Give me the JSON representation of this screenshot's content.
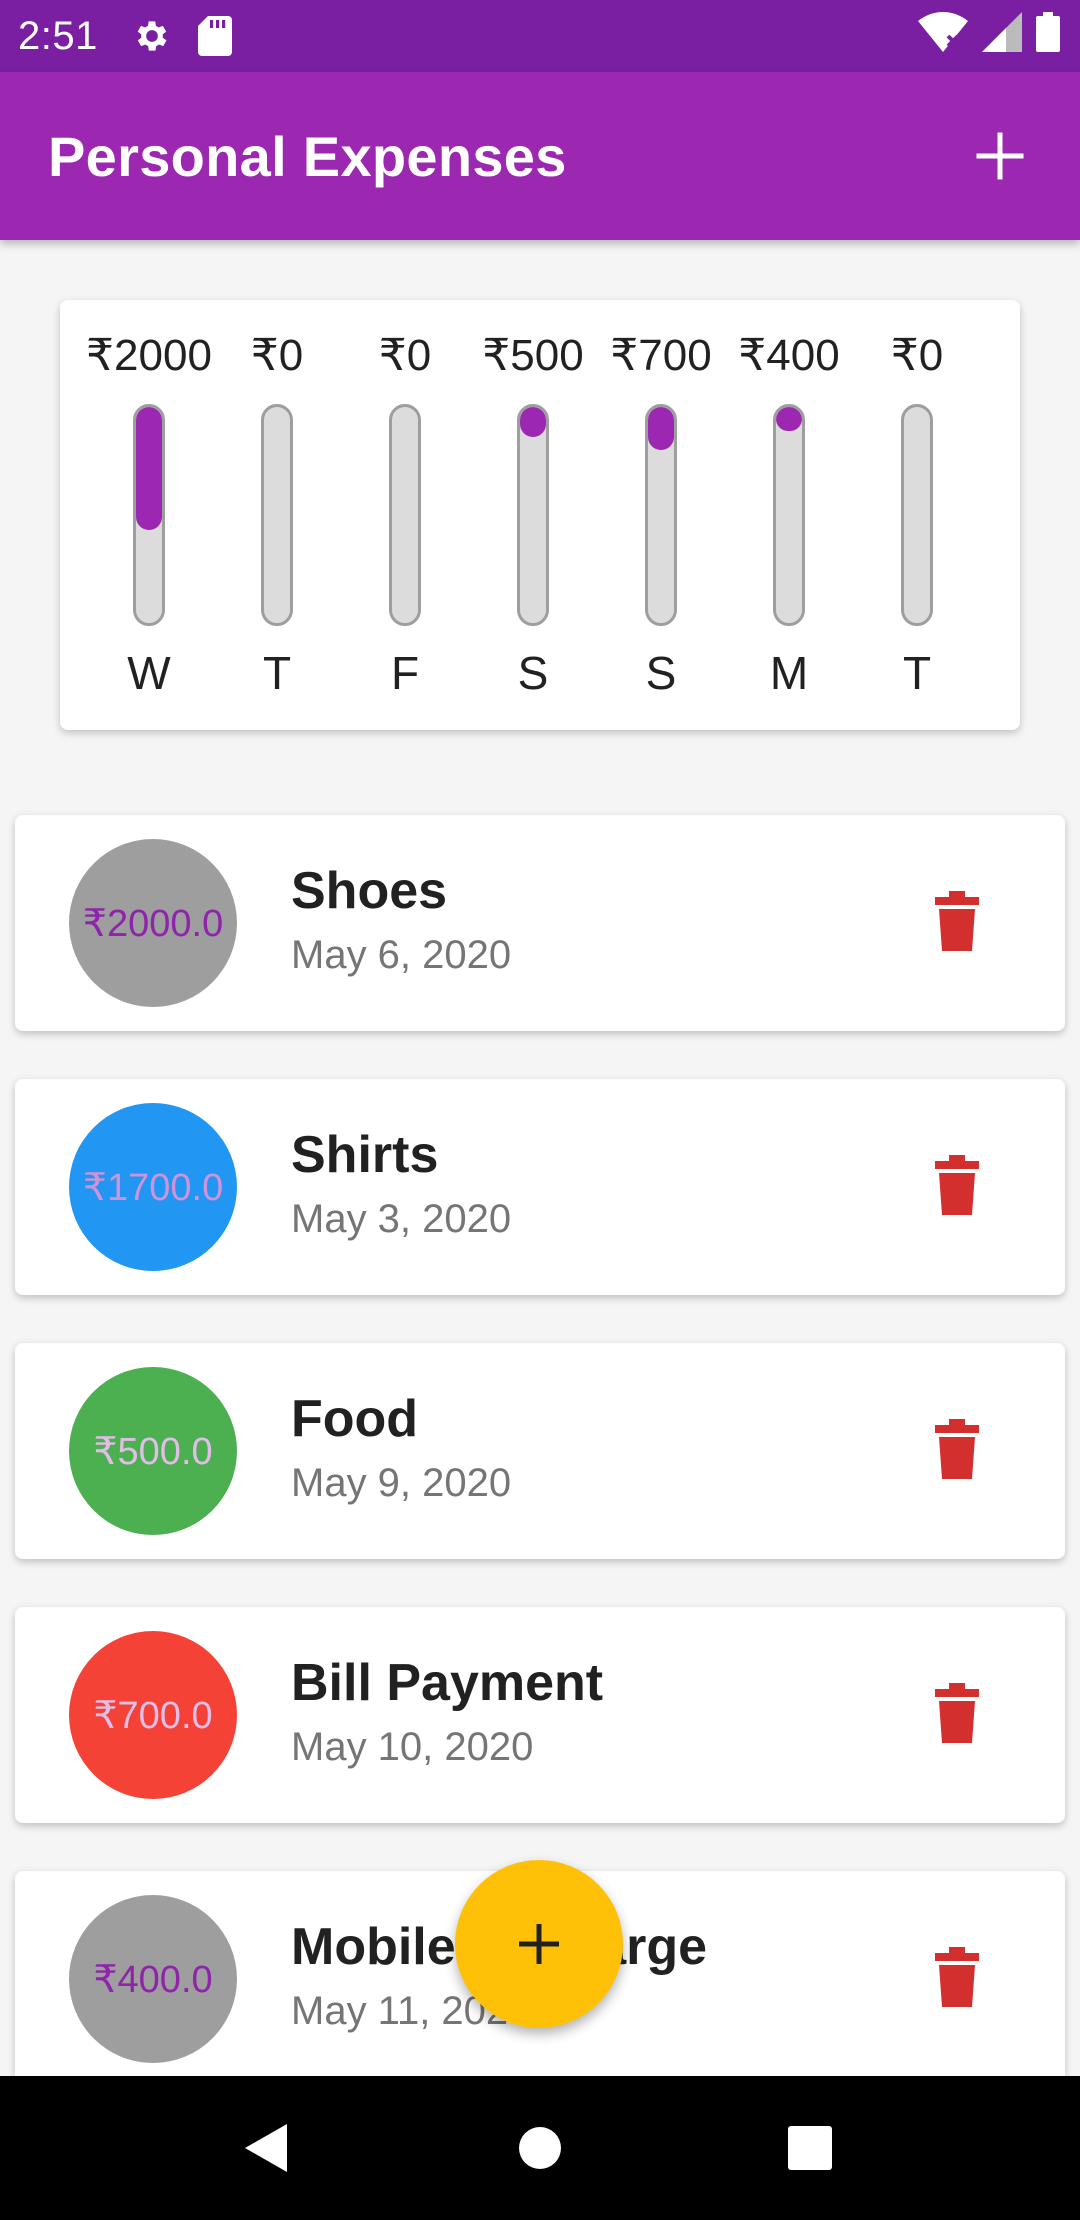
{
  "status_bar": {
    "time": "2:51",
    "icons": [
      "settings-icon",
      "sd-card-icon",
      "wifi-icon",
      "signal-icon",
      "battery-icon"
    ]
  },
  "app_bar": {
    "title": "Personal Expenses",
    "add_icon": "plus-icon"
  },
  "weekly_chart": {
    "bars": [
      {
        "amount": "₹2000",
        "day": "W",
        "fraction": 0.57
      },
      {
        "amount": "₹0",
        "day": "T",
        "fraction": 0
      },
      {
        "amount": "₹0",
        "day": "F",
        "fraction": 0
      },
      {
        "amount": "₹500",
        "day": "S",
        "fraction": 0.14
      },
      {
        "amount": "₹700",
        "day": "S",
        "fraction": 0.2
      },
      {
        "amount": "₹400",
        "day": "M",
        "fraction": 0.11
      },
      {
        "amount": "₹0",
        "day": "T",
        "fraction": 0
      }
    ],
    "fill_color": "#9c27b0"
  },
  "transactions": [
    {
      "amount": "₹2000.0",
      "title": "Shoes",
      "date": "May 6, 2020",
      "avatar_color": "#9e9e9e",
      "amount_color": "#8e24aa"
    },
    {
      "amount": "₹1700.0",
      "title": "Shirts",
      "date": "May 3, 2020",
      "avatar_color": "#2196f3",
      "amount_color": "#ce93d8"
    },
    {
      "amount": "₹500.0",
      "title": "Food",
      "date": "May 9, 2020",
      "avatar_color": "#4caf50",
      "amount_color": "#e1bee7"
    },
    {
      "amount": "₹700.0",
      "title": "Bill Payment",
      "date": "May 10, 2020",
      "avatar_color": "#f44336",
      "amount_color": "#e1bee7"
    },
    {
      "amount": "₹400.0",
      "title": "Mobile Recharge",
      "date": "May 11, 2020",
      "avatar_color": "#9e9e9e",
      "amount_color": "#8e24aa"
    }
  ],
  "delete_icon": "trash-icon",
  "delete_color": "#d32f2f",
  "fab": {
    "icon": "plus-icon",
    "color": "#ffc107"
  },
  "nav_bar": {
    "icons": [
      "back-icon",
      "home-icon",
      "recents-icon"
    ]
  }
}
